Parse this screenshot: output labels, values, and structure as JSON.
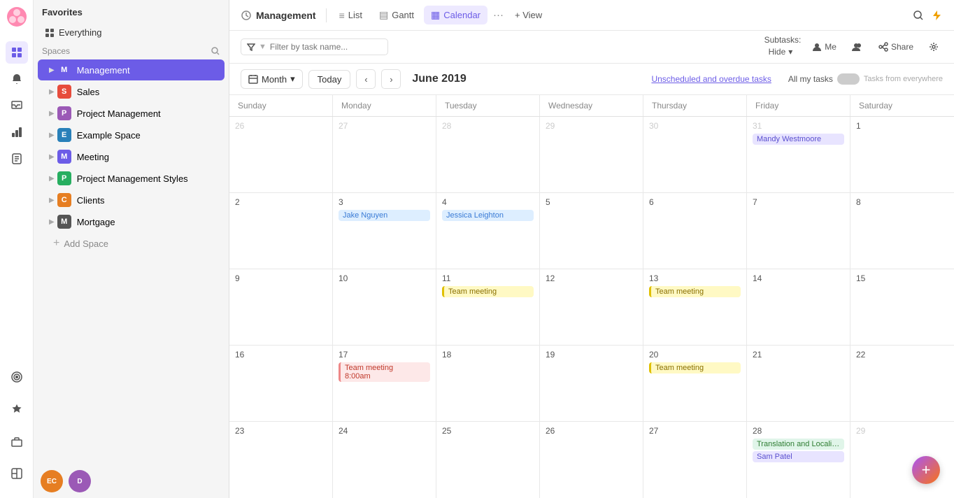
{
  "app": {
    "logo": "🌸"
  },
  "sidebar": {
    "title": "Favorites",
    "spaces_label": "Spaces",
    "everything_label": "Everything",
    "add_space_label": "Add Space",
    "items": [
      {
        "id": "management",
        "label": "Management",
        "color": "#6c5ce7",
        "letter": "M",
        "active": true
      },
      {
        "id": "sales",
        "label": "Sales",
        "color": "#e74c3c",
        "letter": "S",
        "active": false
      },
      {
        "id": "project-management",
        "label": "Project Management",
        "color": "#9b59b6",
        "letter": "P",
        "active": false
      },
      {
        "id": "example-space",
        "label": "Example Space",
        "color": "#2980b9",
        "letter": "E",
        "active": false
      },
      {
        "id": "meeting",
        "label": "Meeting",
        "color": "#6c5ce7",
        "letter": "M",
        "active": false
      },
      {
        "id": "project-management-styles",
        "label": "Project Management Styles",
        "color": "#27ae60",
        "letter": "P",
        "active": false
      },
      {
        "id": "clients",
        "label": "Clients",
        "color": "#e67e22",
        "letter": "C",
        "active": false
      },
      {
        "id": "mortgage",
        "label": "Mortgage",
        "color": "#555",
        "letter": "M",
        "active": false
      }
    ],
    "avatars": [
      {
        "id": "ec",
        "label": "EC",
        "color": "#e67e22"
      },
      {
        "id": "d",
        "label": "D",
        "color": "#9b59b6"
      }
    ]
  },
  "header": {
    "title": "Management",
    "title_icon": "◯",
    "tabs": [
      {
        "id": "list",
        "label": "List",
        "icon": "≡"
      },
      {
        "id": "gantt",
        "label": "Gantt",
        "icon": "▤"
      },
      {
        "id": "calendar",
        "label": "Calendar",
        "icon": "▦",
        "active": true
      }
    ],
    "more_icon": "···",
    "add_view_label": "+ View"
  },
  "toolbar": {
    "filter_placeholder": "Filter by task name...",
    "subtasks_label": "Subtasks:",
    "hide_label": "Hide",
    "me_label": "Me",
    "share_label": "Share",
    "filter_icon": "▼"
  },
  "calendar": {
    "month_label": "Month",
    "today_label": "Today",
    "title": "June 2019",
    "unscheduled_label": "Unscheduled and overdue tasks",
    "all_my_tasks_label": "All my tasks",
    "tasks_from_label": "Tasks from everywhere",
    "days": [
      "Sunday",
      "Monday",
      "Tuesday",
      "Wednesday",
      "Thursday",
      "Friday",
      "Saturday"
    ],
    "weeks": [
      {
        "cells": [
          {
            "date": "26",
            "other": true,
            "events": []
          },
          {
            "date": "27",
            "other": true,
            "events": []
          },
          {
            "date": "28",
            "other": true,
            "events": []
          },
          {
            "date": "29",
            "other": true,
            "events": []
          },
          {
            "date": "30",
            "other": true,
            "events": []
          },
          {
            "date": "31",
            "other": true,
            "events": [
              {
                "label": "Mandy Westmoore",
                "type": "purple"
              }
            ]
          },
          {
            "date": "1",
            "other": false,
            "events": []
          }
        ]
      },
      {
        "cells": [
          {
            "date": "2",
            "other": false,
            "events": []
          },
          {
            "date": "3",
            "other": false,
            "events": [
              {
                "label": "Jake Nguyen",
                "type": "blue"
              }
            ]
          },
          {
            "date": "4",
            "other": false,
            "events": [
              {
                "label": "Jessica Leighton",
                "type": "blue"
              }
            ]
          },
          {
            "date": "5",
            "other": false,
            "events": []
          },
          {
            "date": "6",
            "other": false,
            "events": []
          },
          {
            "date": "7",
            "other": false,
            "events": []
          },
          {
            "date": "8",
            "other": false,
            "events": []
          }
        ]
      },
      {
        "cells": [
          {
            "date": "9",
            "other": false,
            "events": []
          },
          {
            "date": "10",
            "other": false,
            "events": []
          },
          {
            "date": "11",
            "other": false,
            "events": [
              {
                "label": "Team meeting",
                "type": "yellow"
              }
            ]
          },
          {
            "date": "12",
            "other": false,
            "events": []
          },
          {
            "date": "13",
            "other": false,
            "events": [
              {
                "label": "Team meeting",
                "type": "yellow"
              }
            ]
          },
          {
            "date": "14",
            "other": false,
            "events": []
          },
          {
            "date": "15",
            "other": false,
            "events": []
          }
        ]
      },
      {
        "cells": [
          {
            "date": "16",
            "other": false,
            "events": []
          },
          {
            "date": "17",
            "other": false,
            "events": [
              {
                "label": "Team meeting",
                "type": "pink",
                "sublabel": "8:00am"
              }
            ]
          },
          {
            "date": "18",
            "other": false,
            "events": []
          },
          {
            "date": "19",
            "other": false,
            "events": []
          },
          {
            "date": "20",
            "other": false,
            "events": [
              {
                "label": "Team meeting",
                "type": "yellow"
              }
            ]
          },
          {
            "date": "21",
            "other": false,
            "events": []
          },
          {
            "date": "22",
            "other": false,
            "events": []
          }
        ]
      },
      {
        "cells": [
          {
            "date": "23",
            "other": false,
            "events": []
          },
          {
            "date": "24",
            "other": false,
            "events": []
          },
          {
            "date": "25",
            "other": false,
            "events": []
          },
          {
            "date": "26",
            "other": false,
            "events": []
          },
          {
            "date": "27",
            "other": false,
            "events": []
          },
          {
            "date": "28",
            "other": false,
            "events": [
              {
                "label": "Translation and Localization",
                "type": "green"
              },
              {
                "label": "Sam Patel",
                "type": "purple"
              }
            ]
          },
          {
            "date": "29",
            "other": true,
            "events": []
          }
        ]
      }
    ]
  },
  "fab": {
    "icon": "+"
  }
}
